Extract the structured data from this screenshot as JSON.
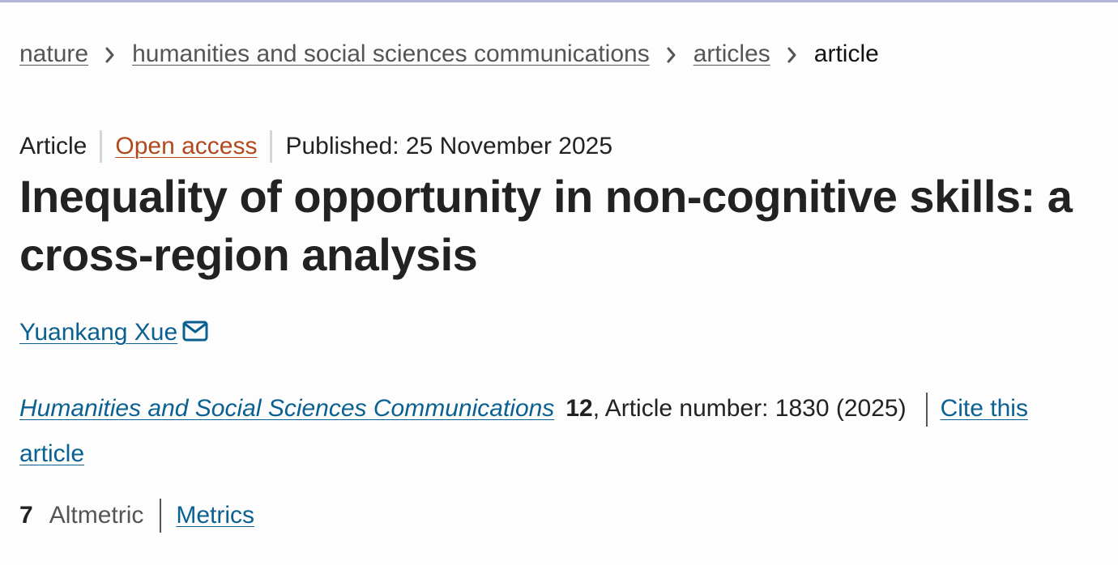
{
  "breadcrumb": {
    "items": [
      "nature",
      "humanities and social sciences communications",
      "articles"
    ],
    "current": "article"
  },
  "meta": {
    "type": "Article",
    "access": "Open access",
    "published": "Published: 25 November 2025"
  },
  "article": {
    "title": "Inequality of opportunity in non-cognitive skills: a cross-region analysis",
    "author": "Yuankang Xue"
  },
  "citation": {
    "journal": "Humanities and Social Sciences Communications",
    "volume": "12",
    "details": ", Article number: 1830 (2025)",
    "cite_label": "Cite this article"
  },
  "metrics": {
    "altmetric_count": "7",
    "altmetric_label": "Altmetric",
    "metrics_label": "Metrics"
  },
  "colors": {
    "link": "#0a6090",
    "open_access": "#b0491e",
    "text": "#222222",
    "top_border": "#b3b3d9"
  },
  "icons": [
    "chevron-right-icon",
    "mail-icon"
  ]
}
